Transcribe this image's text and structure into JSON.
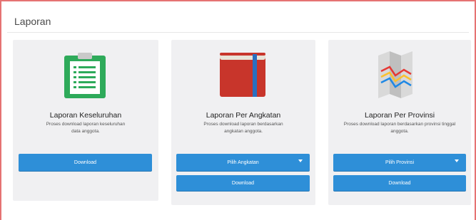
{
  "panel": {
    "title": "Laporan"
  },
  "cards": [
    {
      "title": "Laporan Keseluruhan",
      "description": "Proses download laporan keseluruhan data anggota.",
      "icon": "clipboard-icon",
      "download_label": "Download"
    },
    {
      "title": "Laporan Per Angkatan",
      "description": "Proses download laporan berdasarkan angkatan anggota.",
      "icon": "book-icon",
      "select_label": "Pilih Angkatan",
      "download_label": "Download"
    },
    {
      "title": "Laporan Per Provinsi",
      "description": "Proses download laporan berdasarkan provinsi tinggal anggota.",
      "icon": "map-icon",
      "select_label": "Pilih Provinsi",
      "download_label": "Download"
    }
  ],
  "colors": {
    "accent": "#2e8fd8",
    "border": "#e57373",
    "card_bg": "#f0f0f2"
  }
}
